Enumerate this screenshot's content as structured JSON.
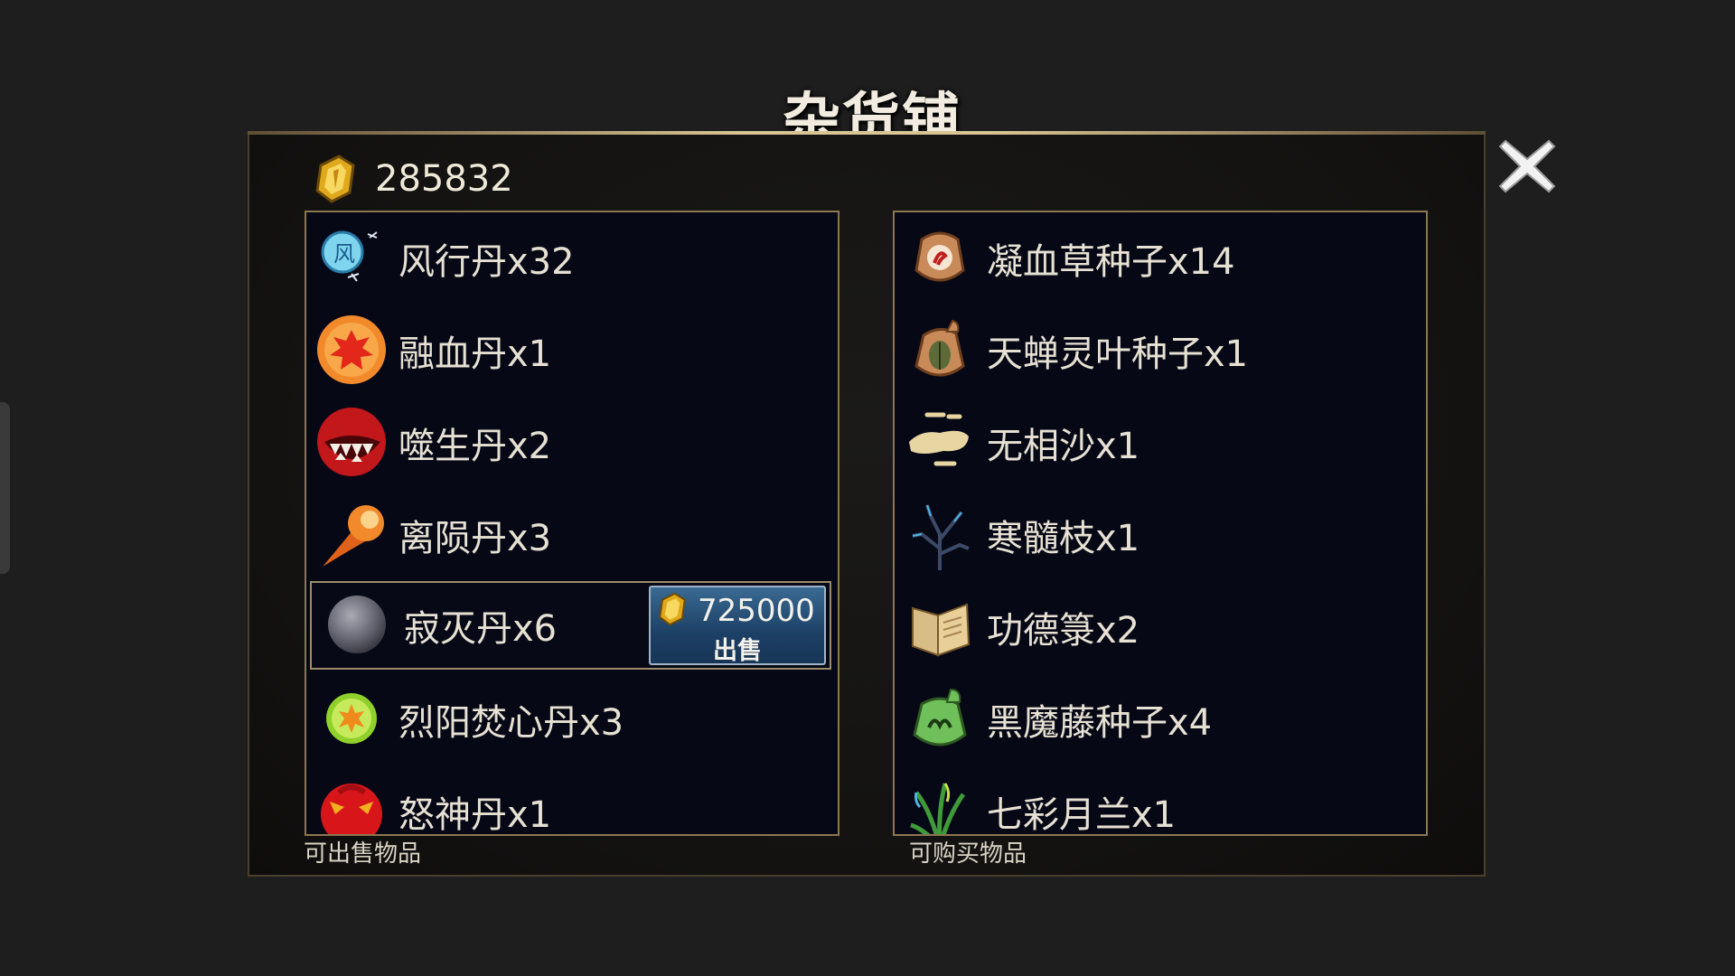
{
  "shop": {
    "title": "杂货铺"
  },
  "currency": {
    "amount": "285832",
    "icon": "gold-gem-icon"
  },
  "sell_list": {
    "caption": "可出售物品",
    "items": [
      {
        "label": "风行丹x32",
        "icon": "wind-pill-icon"
      },
      {
        "label": "融血丹x1",
        "icon": "blood-pill-icon"
      },
      {
        "label": "噬生丹x2",
        "icon": "devour-pill-icon"
      },
      {
        "label": "离陨丹x3",
        "icon": "meteor-pill-icon"
      },
      {
        "label": "寂灭丹x6",
        "icon": "silence-pill-icon",
        "selected": true
      },
      {
        "label": "烈阳焚心丹x3",
        "icon": "sun-pill-icon"
      },
      {
        "label": "怒神丹x1",
        "icon": "wrath-pill-icon"
      }
    ],
    "sell_button": {
      "price": "725000",
      "label": "出售"
    }
  },
  "buy_list": {
    "caption": "可购买物品",
    "items": [
      {
        "label": "凝血草种子x14",
        "icon": "seed-bag-icon"
      },
      {
        "label": "天蝉灵叶种子x1",
        "icon": "cicada-seed-bag-icon"
      },
      {
        "label": "无相沙x1",
        "icon": "sand-icon"
      },
      {
        "label": "寒髓枝x1",
        "icon": "branch-icon"
      },
      {
        "label": "功德箓x2",
        "icon": "scroll-icon"
      },
      {
        "label": "黑魔藤种子x4",
        "icon": "green-seed-bag-icon"
      },
      {
        "label": "七彩月兰x1",
        "icon": "orchid-icon"
      }
    ]
  },
  "colors": {
    "frame_gold": "#8b7750",
    "list_bg": "#070816",
    "sell_button": "#1d4066"
  }
}
